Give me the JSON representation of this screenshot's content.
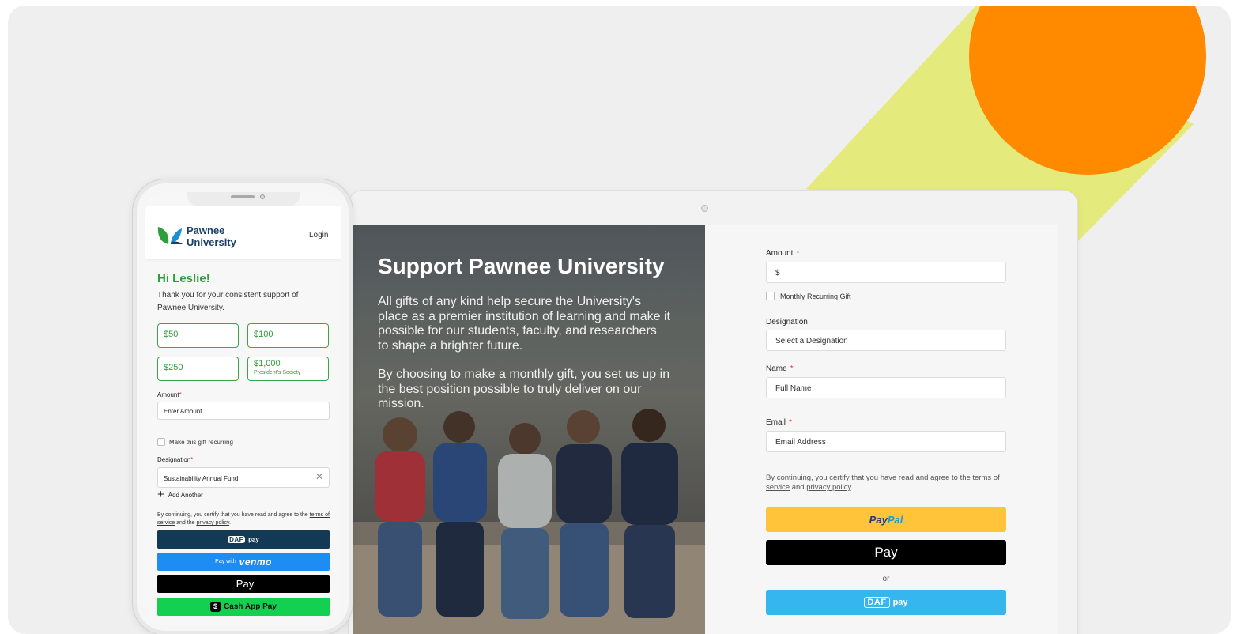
{
  "colors": {
    "sun": "#ff8a00",
    "beam": "#e4ea7c",
    "brand_green": "#2e9d3b",
    "brand_navy": "#1b3f66",
    "paypal_yellow": "#ffc439",
    "dafpay_blue": "#36b6ee",
    "venmo_blue": "#1e8cf5",
    "cashapp_green": "#13d050"
  },
  "desktop": {
    "hero": {
      "title": "Support Pawnee University",
      "paragraph1": "All gifts of any kind help secure the University's place as a premier institution of learning and make it possible for our students, faculty, and researchers to shape a brighter future.",
      "paragraph2": "By choosing to make a monthly gift, you set us up in the best position possible to truly deliver on our mission."
    },
    "form": {
      "amount_label": "Amount",
      "amount_value": "$",
      "monthly_label": "Monthly Recurring Gift",
      "designation_label": "Designation",
      "designation_placeholder": "Select a Designation",
      "name_label": "Name",
      "name_placeholder": "Full Name",
      "email_label": "Email",
      "email_placeholder": "Email Address",
      "required_mark": "*",
      "terms_prefix": "By continuing, you certify that you have read and agree to the ",
      "terms_link": "terms of service",
      "terms_and": " and ",
      "privacy_link": "privacy policy",
      "terms_suffix": ".",
      "paypal_label_a": "Pay",
      "paypal_label_b": "Pal",
      "applepay_label": "Pay",
      "or_label": "or",
      "daf_badge": "DAF",
      "daf_label": "pay"
    }
  },
  "mobile": {
    "brand_line1": "Pawnee",
    "brand_line2": "University",
    "login": "Login",
    "greeting": "Hi Leslie!",
    "thanks": "Thank you for your consistent support of Pawnee University.",
    "amounts": [
      {
        "label": "$50",
        "sub": ""
      },
      {
        "label": "$100",
        "sub": ""
      },
      {
        "label": "$250",
        "sub": ""
      },
      {
        "label": "$1,000",
        "sub": "President's Society"
      }
    ],
    "amount_label": "Amount",
    "required_mark": "*",
    "amount_placeholder": "Enter Amount",
    "recurring_label": "Make this gift recurring",
    "designation_label": "Designation",
    "designation_value": "Sustainability Annual Fund",
    "clear": "✕",
    "add_another": "Add Another",
    "terms_prefix": "By continuing, you certify that you have read and agree to the ",
    "terms_link": "terms of service",
    "terms_and": " and the ",
    "privacy_link": "privacy policy",
    "terms_suffix": ".",
    "daf_badge": "DAF",
    "daf_label": "pay",
    "venmo_prefix": "Pay with",
    "venmo_label": "venmo",
    "applepay_label": "Pay",
    "cash_icon": "$",
    "cashapp_label": "Cash App Pay"
  }
}
